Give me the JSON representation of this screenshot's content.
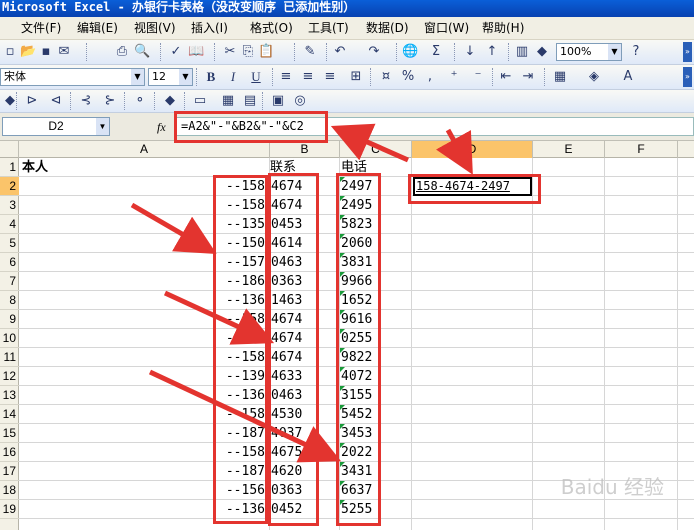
{
  "window": {
    "title": "Microsoft Excel - 办银行卡表格（没改变顺序 已添加性别）"
  },
  "menu": [
    "文件(F)",
    "编辑(E)",
    "视图(V)",
    "插入(I)",
    "格式(O)",
    "工具(T)",
    "数据(D)",
    "窗口(W)",
    "帮助(H)"
  ],
  "toolbar": {
    "zoom": "100%",
    "font_name": "宋体",
    "font_size": "12",
    "bold": "B",
    "italic": "I",
    "underline": "U",
    "percent": "%",
    "comma": ",",
    "sigma": "Σ"
  },
  "formula_bar": {
    "name_box": "D2",
    "fx": "fx",
    "formula": "=A2&\"-\"&B2&\"-\"&C2"
  },
  "columns": [
    {
      "id": "A",
      "label": "A"
    },
    {
      "id": "B",
      "label": "B"
    },
    {
      "id": "C",
      "label": "C"
    },
    {
      "id": "D",
      "label": "D"
    },
    {
      "id": "E",
      "label": "E"
    },
    {
      "id": "F",
      "label": "F"
    }
  ],
  "rows": [
    "1",
    "2",
    "3",
    "4",
    "5",
    "6",
    "7",
    "8",
    "9",
    "10",
    "11",
    "12",
    "13",
    "14",
    "15",
    "16",
    "17",
    "18",
    "19"
  ],
  "headers": {
    "a": "本人",
    "b": "联系",
    "c": "电话"
  },
  "cells": [
    {
      "a": "--158",
      "b": "4674",
      "c": "2497"
    },
    {
      "a": "--158",
      "b": "4674",
      "c": "2495"
    },
    {
      "a": "--135",
      "b": "0453",
      "c": "5823"
    },
    {
      "a": "--150",
      "b": "4614",
      "c": "2060"
    },
    {
      "a": "--157",
      "b": "0463",
      "c": "3831"
    },
    {
      "a": "--186",
      "b": "0363",
      "c": "9966"
    },
    {
      "a": "--136",
      "b": "1463",
      "c": "1652"
    },
    {
      "a": "--158",
      "b": "4674",
      "c": "9616"
    },
    {
      "a": "--158",
      "b": "4674",
      "c": "0255"
    },
    {
      "a": "--158",
      "b": "4674",
      "c": "9822"
    },
    {
      "a": "--139",
      "b": "4633",
      "c": "4072"
    },
    {
      "a": "--136",
      "b": "0463",
      "c": "3155"
    },
    {
      "a": "--158",
      "b": "4530",
      "c": "5452"
    },
    {
      "a": "--187",
      "b": "4037",
      "c": "3453"
    },
    {
      "a": "--158",
      "b": "4675",
      "c": "2022"
    },
    {
      "a": "--187",
      "b": "4620",
      "c": "3431"
    },
    {
      "a": "--156",
      "b": "0363",
      "c": "6637"
    },
    {
      "a": "--136",
      "b": "0452",
      "c": "5255"
    }
  ],
  "result": {
    "d2": "158-4674-2497"
  },
  "watermark": "Baidu 经验",
  "colors": {
    "title_bar": "#0841b0",
    "selected_header": "#fbc46a",
    "annotation_red": "#e3342f",
    "error_triangle": "#1a9a3a"
  }
}
